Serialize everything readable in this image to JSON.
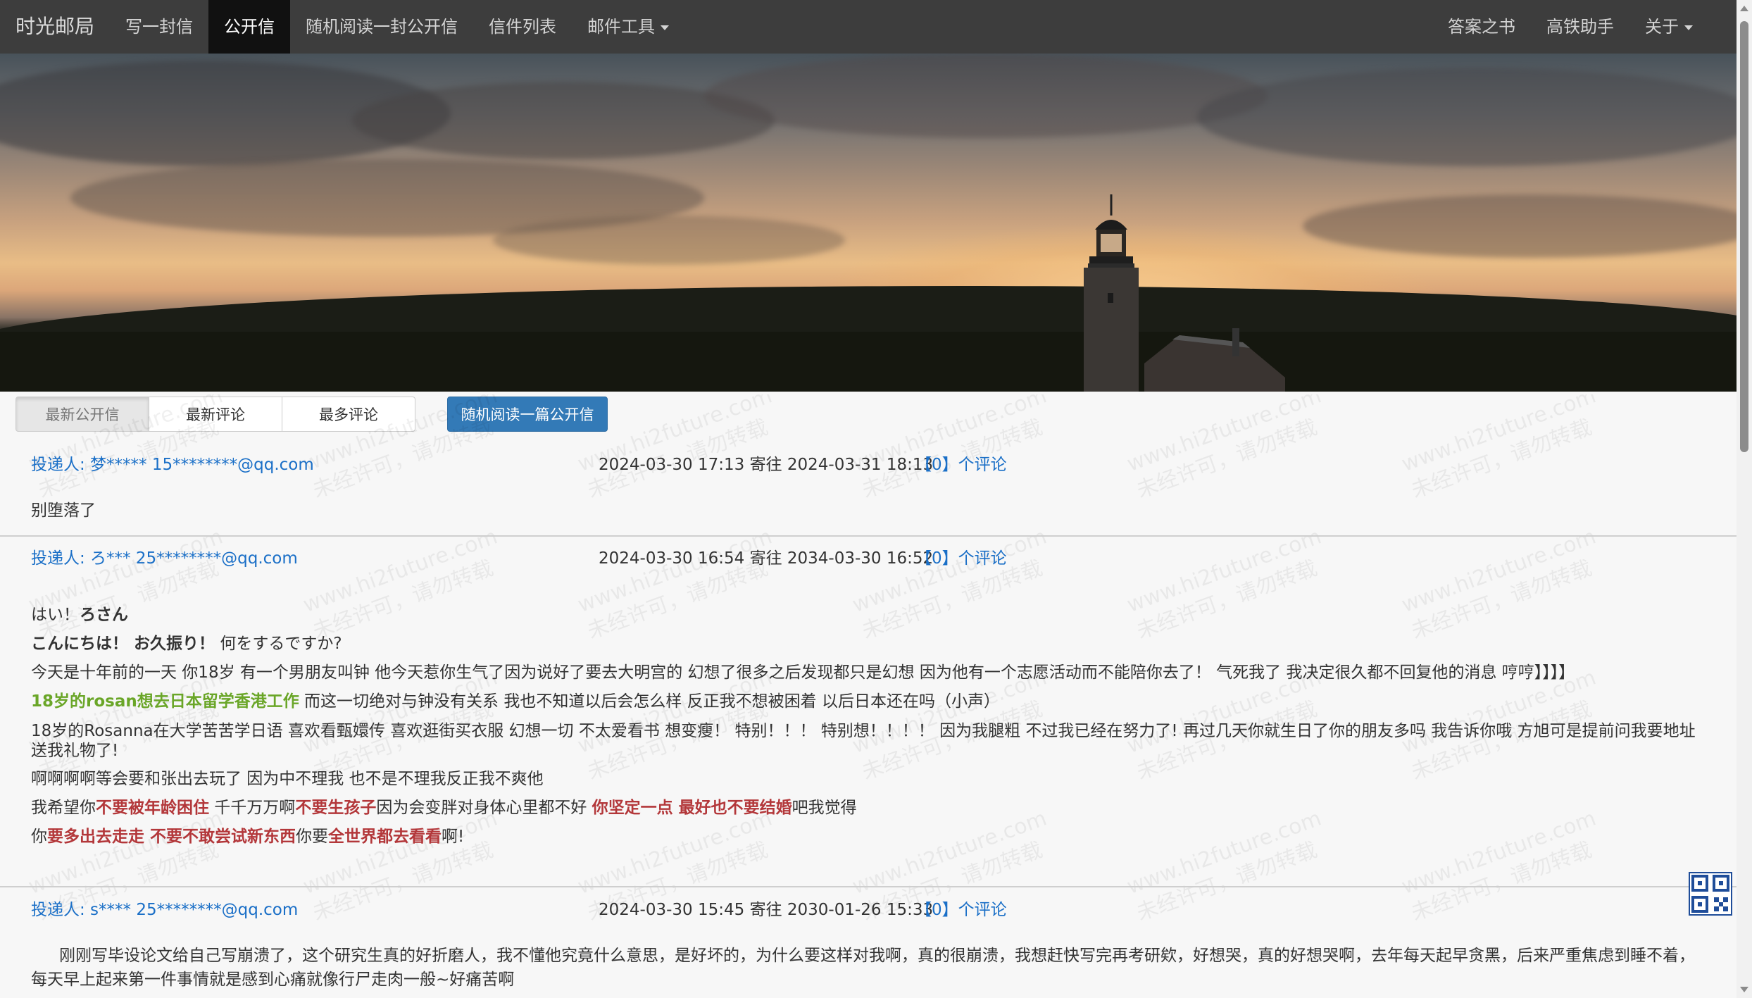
{
  "nav": {
    "brand": "时光邮局",
    "items": [
      "写一封信",
      "公开信",
      "随机阅读一封公开信",
      "信件列表",
      "邮件工具"
    ],
    "right_items": [
      "答案之书",
      "高铁助手",
      "关于"
    ]
  },
  "tabs": [
    "最新公开信",
    "最新评论",
    "最多评论"
  ],
  "random_button": "随机阅读一篇公开信",
  "watermark": {
    "line1": "www.hi2future.com",
    "line2": "未经许可，请勿转载"
  },
  "letters": [
    {
      "sender": "投递人: 梦***** 15********@qq.com",
      "time": "2024-03-30 17:13 寄往 2024-03-31 18:13",
      "comments": "【0】个评论",
      "body": "别堕落了"
    },
    {
      "sender": "投递人: ろ*** 25********@qq.com",
      "time": "2024-03-30 16:54 寄往 2034-03-30 16:52",
      "comments": "【0】个评论",
      "lines": {
        "l1a": "はい！",
        "l1b": "ろさん",
        "l2a": "こんにちは！ お久振り！",
        "l2b": " 何をするですか?",
        "l3": "今天是十年前的一天 你18岁 有一个男朋友叫钟 他今天惹你生气了因为说好了要去大明宫的 幻想了很多之后发现都只是幻想 因为他有一个志愿活动而不能陪你去了！ 气死我了 我决定很久都不回复他的消息 哼哼】】】】",
        "l4a": "18岁的rosan想去日本留学香港工作",
        "l4b": " 而这一切绝对与钟没有关系 我也不知道以后会怎么样 反正我不想被困着 以后日本还在吗（小声）",
        "l5": "18岁的Rosanna在大学苦苦学日语 喜欢看甄嬛传 喜欢逛街买衣服 幻想一切 不太爱看书 想变瘦！ 特别！！！ 特别想！！！！ 因为我腿粗 不过我已经在努力了! 再过几天你就生日了你的朋友多吗 我告诉你哦 方旭可是提前问我要地址送我礼物了!",
        "l6": "啊啊啊啊等会要和张出去玩了 因为中不理我 也不是不理我反正我不爽他",
        "l7a": "我希望你",
        "l7b": "不要被年龄困住",
        "l7c": " 千千万万啊",
        "l7d": "不要生孩子",
        "l7e": "因为会变胖对身体心里都不好 ",
        "l7f": "你坚定一点 最好也不要结婚",
        "l7g": "吧我觉得",
        "l8a": "你",
        "l8b": "要多出去走走 不要不敢尝试新东西",
        "l8c": "你要",
        "l8d": "全世界都去看看",
        "l8e": "啊!"
      }
    },
    {
      "sender": "投递人: s**** 25********@qq.com",
      "time": "2024-03-30 15:45 寄往 2030-01-26 15:33",
      "comments": "【0】个评论",
      "body": "刚刚写毕设论文给自己写崩溃了，这个研究生真的好折磨人，我不懂他究竟什么意思，是好坏的，为什么要这样对我啊，真的很崩溃，我想赶快写完再考研欸，好想哭，真的好想哭啊，去年每天起早贪黑，后来严重焦虑到睡不着，每天早上起来第一件事情就是感到心痛就像行尸走肉一般~好痛苦啊"
    }
  ],
  "colors": {
    "navbar": "#3d3d3d",
    "link": "#1a6fc7",
    "primary": "#337ab7",
    "green_text": "#6aa628",
    "red_text": "#b3373a"
  },
  "icons": [
    "qr-code-icon"
  ]
}
